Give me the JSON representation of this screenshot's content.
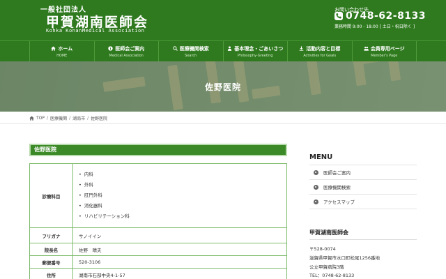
{
  "header": {
    "org_type": "一般社団法人",
    "org_name": "甲賀湖南医師会",
    "org_name_en": "Kohka KonanMedical Association",
    "contact_label": "お問い合わせ先",
    "phone": "0748-62-8133",
    "hours": "業務時間 9:00 - 18:00 [ 土日・祝日除く ]"
  },
  "nav": [
    {
      "label": "ホーム",
      "sub": "HOME",
      "icon": "home-icon"
    },
    {
      "label": "医師会ご案内",
      "sub": "Medical Association",
      "icon": "info-icon"
    },
    {
      "label": "医療機関検索",
      "sub": "Search",
      "icon": "search-icon"
    },
    {
      "label": "基本理念・ごあいさつ",
      "sub": "Philosophy-Greeting",
      "icon": "person-icon"
    },
    {
      "label": "活動内容と目標",
      "sub": "Activities for Goals",
      "icon": "download-icon"
    },
    {
      "label": "会員専用ページ",
      "sub": "Member's Page",
      "icon": "members-icon"
    }
  ],
  "hero": {
    "title": "佐野医院"
  },
  "breadcrumb": [
    "TOP",
    "医療機関",
    "湖南市",
    "佐野医院"
  ],
  "section": {
    "title": "佐野医院"
  },
  "table": {
    "departments_label": "診療科目",
    "departments": [
      "内科",
      "外科",
      "肛門外科",
      "消化器科",
      "リハビリテーション科"
    ],
    "rows": [
      {
        "label": "フリガナ",
        "value": "サノイイン"
      },
      {
        "label": "院長名",
        "value": "佐野　晴夫"
      },
      {
        "label": "郵便番号",
        "value": "520-3106"
      },
      {
        "label": "住所",
        "value": "湖南市石部中央4-1-57"
      }
    ]
  },
  "sidebar": {
    "menu_title": "MENU",
    "menu": [
      "医師会ご案内",
      "医療機関検索",
      "アクセスマップ"
    ],
    "org_title": "甲賀湖南医師会",
    "org_lines": [
      "〒528-0074",
      "滋賀県甲賀市水口町松尾1256番地",
      "公立甲賀病院3階",
      "TEL：0748-62-8133"
    ]
  },
  "colors": {
    "brand_green": "#2f7a1f",
    "table_border": "#7dbb6b",
    "title_bar": "#3b8a27"
  }
}
